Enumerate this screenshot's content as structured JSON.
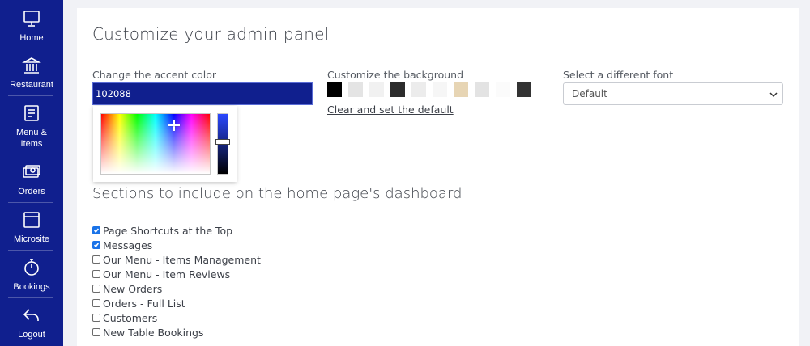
{
  "sidebar": {
    "items": [
      {
        "label": "Home",
        "icon": "monitor-icon"
      },
      {
        "label": "Restaurant",
        "icon": "building-icon"
      },
      {
        "label": "Menu &\nItems",
        "icon": "menu-book-icon"
      },
      {
        "label": "Orders",
        "icon": "cash-icon"
      },
      {
        "label": "Microsite",
        "icon": "browser-window-icon"
      },
      {
        "label": "Bookings",
        "icon": "stopwatch-icon"
      },
      {
        "label": "Logout",
        "icon": "reply-arrow-icon"
      }
    ],
    "bg_color": "#101f8e"
  },
  "main": {
    "title": "Customize your admin panel",
    "accent": {
      "label": "Change the accent color",
      "value": "102088",
      "color": "#102088"
    },
    "background": {
      "label": "Customize the background",
      "swatches": [
        "#000000",
        "#e4e4e4",
        "#f1f1f1",
        "#2c2c2c",
        "#ececec",
        "#f6f6f6",
        "#e7d5b4",
        "#e3e3e3",
        "#fbfbfb",
        "#333333"
      ],
      "clear_label": "Clear and set the default"
    },
    "font": {
      "label": "Select a different font",
      "selected": "Default"
    },
    "dashboard": {
      "title": "Sections to include on the home page's dashboard",
      "items": [
        {
          "label": "Page Shortcuts at the Top",
          "checked": true
        },
        {
          "label": "Messages",
          "checked": true
        },
        {
          "label": "Our Menu - Items Management",
          "checked": false
        },
        {
          "label": "Our Menu - Item Reviews",
          "checked": false
        },
        {
          "label": "New Orders",
          "checked": false
        },
        {
          "label": "Orders - Full List",
          "checked": false
        },
        {
          "label": "Customers",
          "checked": false
        },
        {
          "label": "New Table Bookings",
          "checked": false
        }
      ]
    }
  }
}
